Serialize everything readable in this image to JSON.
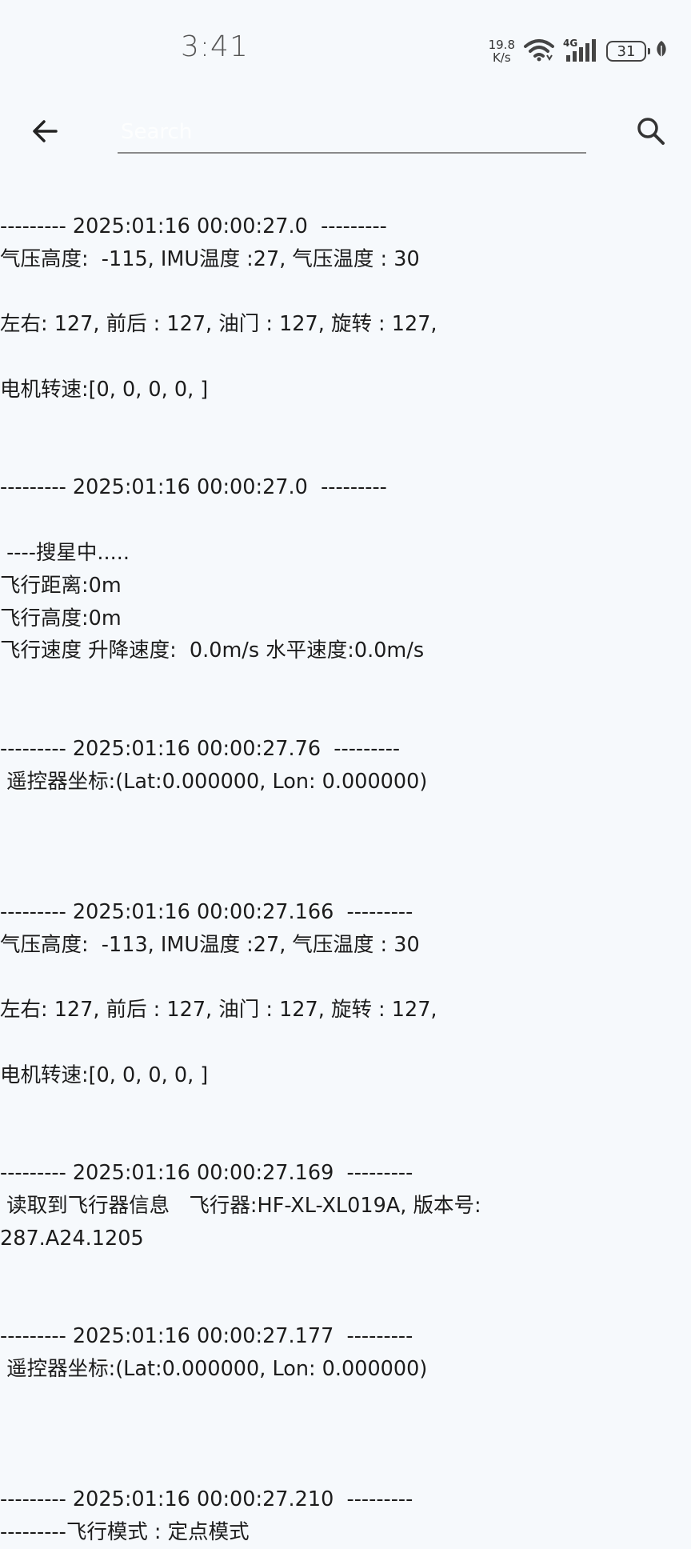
{
  "status_bar": {
    "time": "3:41",
    "net_speed_value": "19.8",
    "net_speed_unit": "K/s",
    "signal_label": "4G",
    "battery": "31"
  },
  "toolbar": {
    "search_placeholder": "Search"
  },
  "log_text": "--------- 2025:01:16 00:00:27.0  ---------\n气压高度:  -115, IMU温度 :27, 气压温度 : 30\n\n左右: 127, 前后 : 127, 油门 : 127, 旋转 : 127,\n\n电机转速:[0, 0, 0, 0, ]\n\n\n--------- 2025:01:16 00:00:27.0  ---------\n\n ----搜星中.....\n飞行距离:0m\n飞行高度:0m\n飞行速度 升降速度:  0.0m/s 水平速度:0.0m/s\n\n\n--------- 2025:01:16 00:00:27.76  ---------\n 遥控器坐标:(Lat:0.000000, Lon: 0.000000)\n\n\n\n--------- 2025:01:16 00:00:27.166  ---------\n气压高度:  -113, IMU温度 :27, 气压温度 : 30\n\n左右: 127, 前后 : 127, 油门 : 127, 旋转 : 127,\n\n电机转速:[0, 0, 0, 0, ]\n\n\n--------- 2025:01:16 00:00:27.169  ---------\n 读取到飞行器信息   飞行器:HF-XL-XL019A, 版本号:\n287.A24.1205\n\n\n--------- 2025:01:16 00:00:27.177  ---------\n 遥控器坐标:(Lat:0.000000, Lon: 0.000000)\n\n\n\n--------- 2025:01:16 00:00:27.210  ---------\n---------飞行模式 : 定点模式"
}
